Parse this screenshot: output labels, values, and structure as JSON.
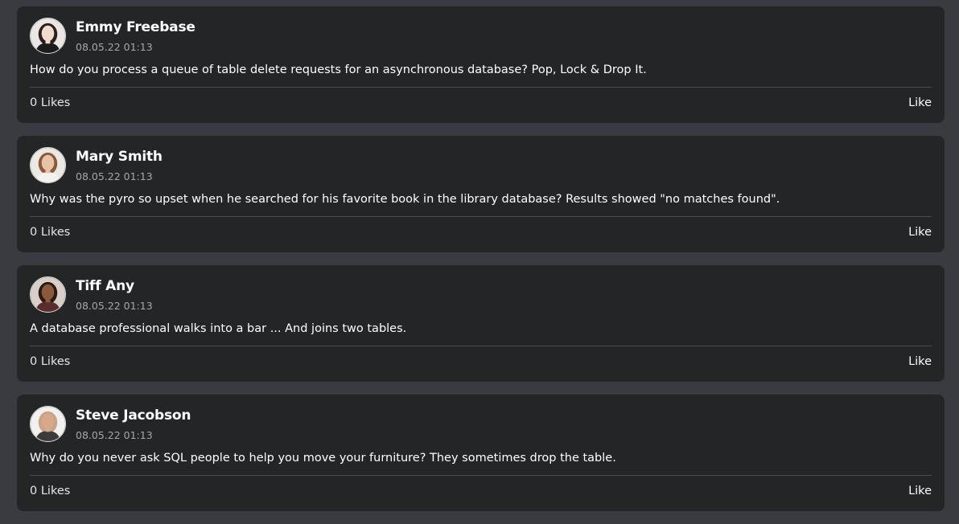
{
  "posts": [
    {
      "author": "Emmy Freebase",
      "timestamp": "08.05.22 01:13",
      "text": "How do you process a queue of table delete requests for an asynchronous database? Pop, Lock & Drop It.",
      "likes_label": "0 Likes",
      "like_button": "Like",
      "avatar": {
        "icon": "avatar-photo",
        "skin": "#f1d9cc",
        "hair": "#2a1f1d",
        "bg": "#e9e6e4",
        "shirt": "#1c1c1c"
      }
    },
    {
      "author": "Mary Smith",
      "timestamp": "08.05.22 01:13",
      "text": "Why was the pyro so upset when he searched for his favorite book in the library database? Results showed \"no matches found\".",
      "likes_label": "0 Likes",
      "like_button": "Like",
      "avatar": {
        "icon": "avatar-photo",
        "skin": "#e8c3a8",
        "hair": "#8a5a3a",
        "bg": "#ece8e4",
        "shirt": "#f4f1ee"
      }
    },
    {
      "author": "Tiff Any",
      "timestamp": "08.05.22 01:13",
      "text": "A database professional walks into a bar ... And joins two tables.",
      "likes_label": "0 Likes",
      "like_button": "Like",
      "avatar": {
        "icon": "avatar-photo",
        "skin": "#8b5a3c",
        "hair": "#2b1a14",
        "bg": "#d9cfc8",
        "shirt": "#5a2c2c"
      }
    },
    {
      "author": "Steve Jacobson",
      "timestamp": "08.05.22 01:13",
      "text": "Why do you never ask SQL people to help you move your furniture? They sometimes drop the table.",
      "likes_label": "0 Likes",
      "like_button": "Like",
      "avatar": {
        "icon": "avatar-photo",
        "skin": "#d9a88a",
        "hair": "#c9a28a",
        "bg": "#f2f0ee",
        "shirt": "#3c3a3a"
      }
    }
  ],
  "colors": {
    "page_bg": "#3a3b40",
    "card_bg": "#242527",
    "text_primary": "#ffffff",
    "text_secondary": "#a5a6aa",
    "divider": "#4b4c50"
  }
}
